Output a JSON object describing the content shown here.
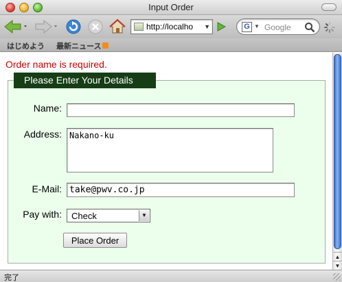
{
  "window": {
    "title": "Input Order"
  },
  "toolbar": {
    "url": "http://localho",
    "search_placeholder": "Google",
    "search_engine_letter": "G"
  },
  "bookmarks": [
    {
      "label": "はじめよう"
    },
    {
      "label": "最新ニュース"
    }
  ],
  "page": {
    "error_message": "Order name is required.",
    "legend": "Please Enter Your Details",
    "labels": {
      "name": "Name:",
      "address": "Address:",
      "email": "E-Mail:",
      "pay_with": "Pay with:"
    },
    "values": {
      "name": "",
      "address": "Nakano-ku",
      "email": "take@pwv.co.jp",
      "pay_with": "Check"
    },
    "submit_label": "Place Order"
  },
  "status": {
    "text": "完了"
  },
  "colors": {
    "error": "#cc0000",
    "legend_bg": "#163d16",
    "fieldset_bg": "#ecffec",
    "scroll_thumb": "#3b6fc6"
  }
}
